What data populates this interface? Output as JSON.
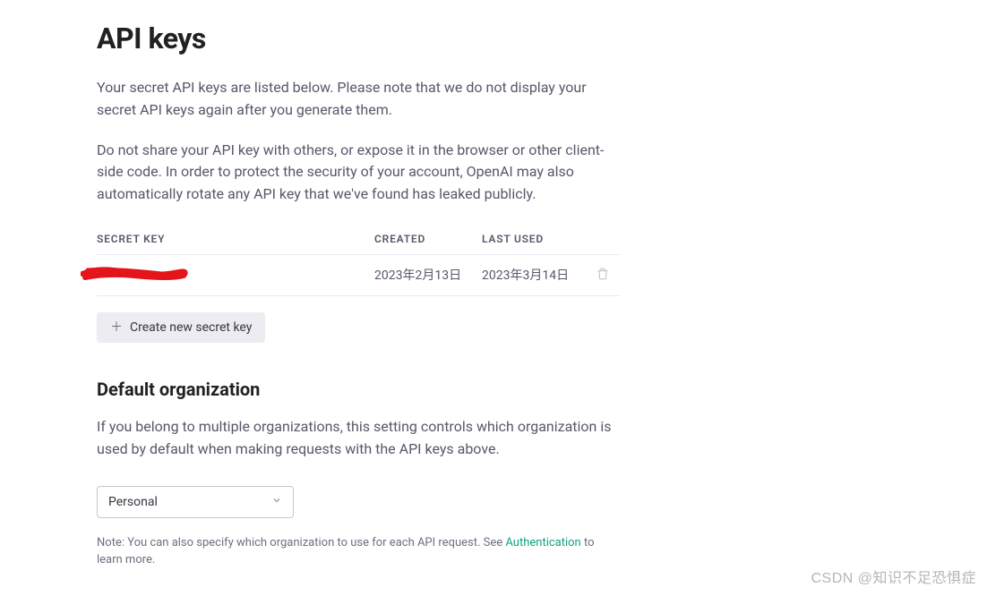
{
  "page": {
    "title": "API keys",
    "intro1": "Your secret API keys are listed below. Please note that we do not display your secret API keys again after you generate them.",
    "intro2": "Do not share your API key with others, or expose it in the browser or other client-side code. In order to protect the security of your account, OpenAI may also automatically rotate any API key that we've found has leaked publicly."
  },
  "table": {
    "headers": {
      "secret": "SECRET KEY",
      "created": "CREATED",
      "lastused": "LAST USED"
    },
    "rows": [
      {
        "secret_redacted": true,
        "created": "2023年2月13日",
        "last_used": "2023年3月14日"
      }
    ]
  },
  "buttons": {
    "create_key": "Create new secret key"
  },
  "org": {
    "section_title": "Default organization",
    "description": "If you belong to multiple organizations, this setting controls which organization is used by default when making requests with the API keys above.",
    "selected": "Personal",
    "note_prefix": "Note: You can also specify which organization to use for each API request. See ",
    "note_link": "Authentication",
    "note_suffix": " to learn more."
  },
  "watermark": "CSDN @知识不足恐惧症"
}
